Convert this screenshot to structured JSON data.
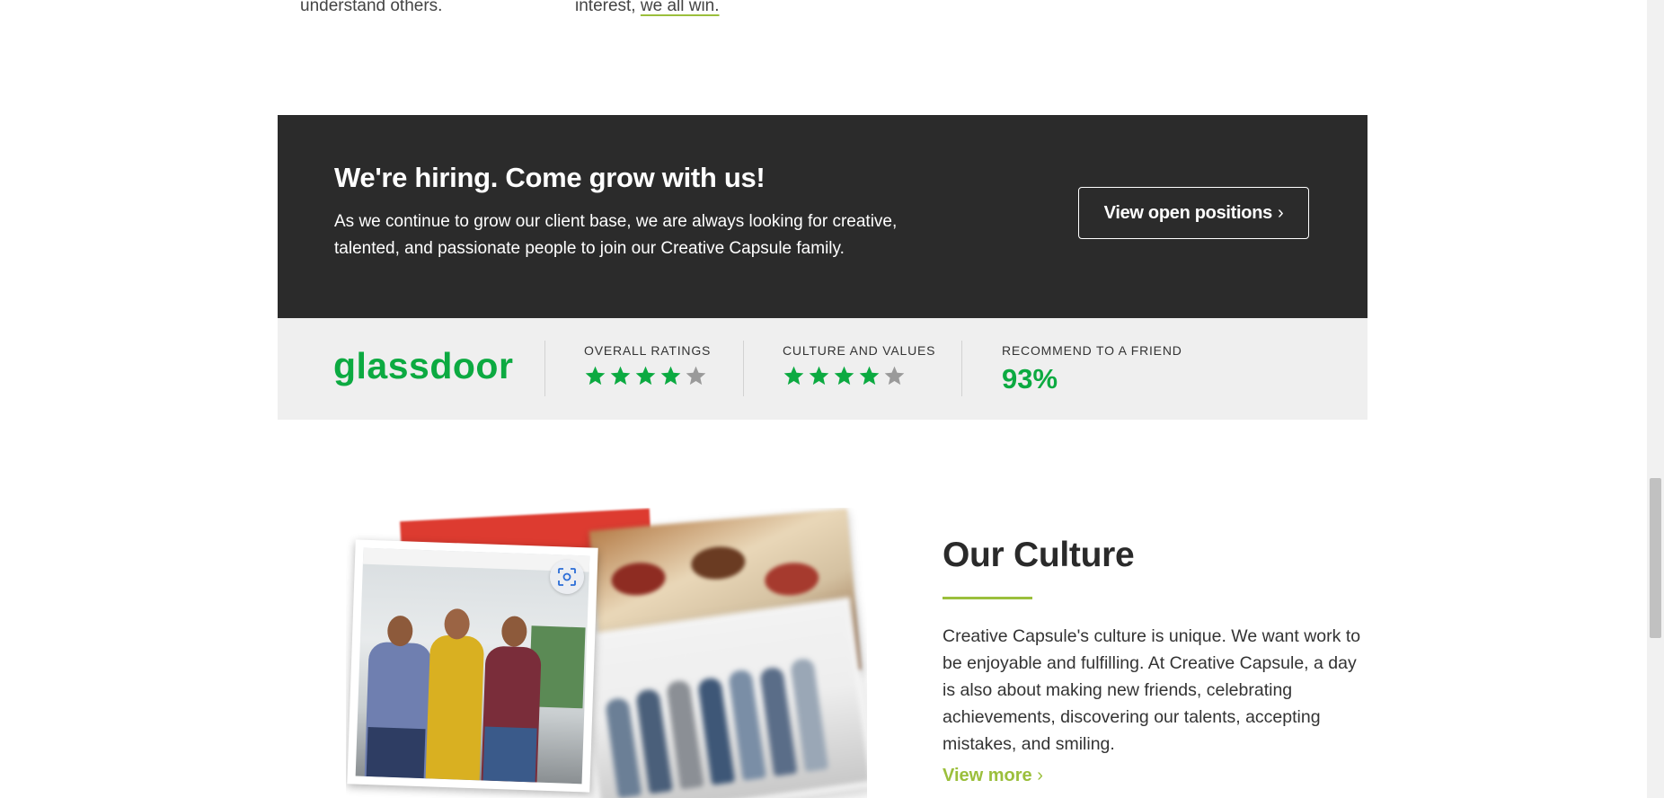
{
  "top": {
    "left_text": "understand others.",
    "right_text_prefix": "interest, ",
    "right_text_underlined": "we all win."
  },
  "hiring": {
    "title": "We're hiring. Come grow with us!",
    "description": "As we continue to grow our client base, we are always looking for creative, talented, and passionate people to join our Creative Capsule family.",
    "button_label": "View open positions",
    "button_chevron": "›"
  },
  "glassdoor": {
    "logo": "glassdoor",
    "overall_label": "OVERALL RATINGS",
    "overall_rating": 4,
    "overall_max": 5,
    "culture_label": "CULTURE AND VALUES",
    "culture_rating": 4,
    "culture_max": 5,
    "recommend_label": "RECOMMEND TO A FRIEND",
    "recommend_value": "93%",
    "colors": {
      "brand": "#0caa41",
      "star_empty": "#9a9a9a"
    }
  },
  "culture": {
    "title": "Our Culture",
    "description": "Creative Capsule's culture is unique. We want work to be enjoyable and fulfilling. At Creative Capsule, a day is also about making new friends, celebrating achievements, discovering our talents, accepting mistakes, and smiling.",
    "link_label": "View more",
    "link_chevron": "›",
    "image_overlay_icon": "lens-icon"
  },
  "colors": {
    "accent_green": "#9bbf3c",
    "banner_bg": "#2b2b2b",
    "strip_bg": "#efefef"
  }
}
